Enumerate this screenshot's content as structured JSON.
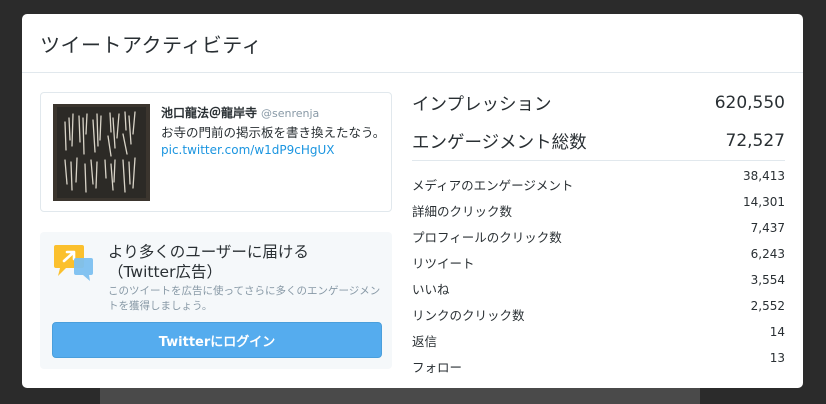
{
  "modal": {
    "title": "ツイートアクティビティ"
  },
  "tweet": {
    "name": "池口龍法＠龍岸寺",
    "handle": "@senrenja",
    "text": "お寺の門前の掲示板を書き換えたなう。",
    "link": "pic.twitter.com/w1dP9cHgUX"
  },
  "promo": {
    "title_line1": "より多くのユーザーに届ける",
    "title_line2": "（Twitter広告）",
    "description": "このツイートを広告に使ってさらに多くのエンゲージメントを獲得しましょう。",
    "button_label": "Twitterにログイン"
  },
  "stats": {
    "impressions": {
      "label": "インプレッション",
      "value": "620,550"
    },
    "engagements": {
      "label": "エンゲージメント総数",
      "value": "72,527"
    },
    "breakdown": [
      {
        "label": "メディアのエンゲージメント",
        "value": "38,413"
      },
      {
        "label": "詳細のクリック数",
        "value": "14,301"
      },
      {
        "label": "プロフィールのクリック数",
        "value": "7,437"
      },
      {
        "label": "リツイート",
        "value": "6,243"
      },
      {
        "label": "いいね",
        "value": "3,554"
      },
      {
        "label": "リンクのクリック数",
        "value": "2,552"
      },
      {
        "label": "返信",
        "value": "14"
      },
      {
        "label": "フォロー",
        "value": "13"
      }
    ]
  },
  "icons": {
    "promo": "megaphone-speech-bubble-icon"
  },
  "colors": {
    "accent": "#55acee",
    "link": "#1b95e0",
    "promo_icon_yellow": "#fbc02d",
    "promo_icon_blue": "#7cc0f0"
  }
}
